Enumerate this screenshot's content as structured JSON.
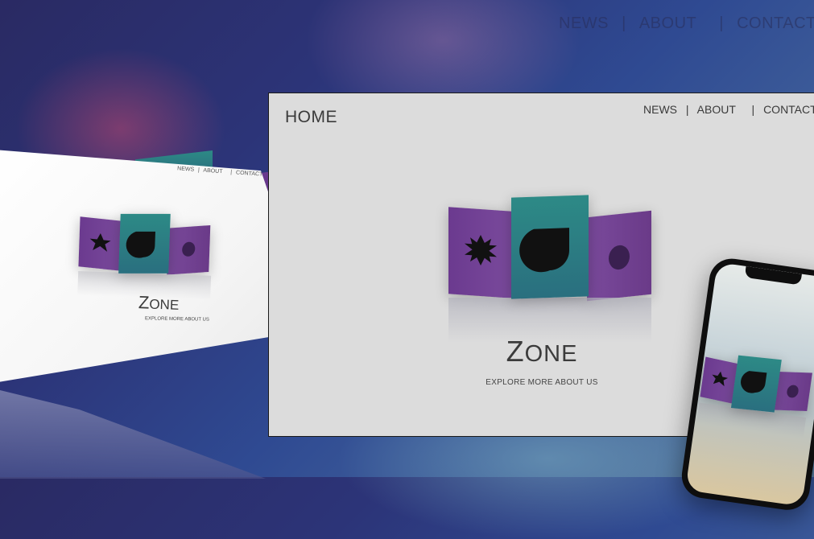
{
  "background": {
    "nav": {
      "news": "NEWS",
      "about": "ABOUT",
      "contact": "CONTACT",
      "sep": "|"
    }
  },
  "desktop": {
    "home": "HOME",
    "nav": {
      "news": "NEWS",
      "about": "ABOUT",
      "contact": "CONTACT",
      "sep": "|"
    },
    "brand_first": "Z",
    "brand_rest": "ONE",
    "tagline": "EXPLORE MORE ABOUT US"
  },
  "tablet": {
    "nav": {
      "news": "NEWS",
      "about": "ABOUT",
      "contact": "CONTACT",
      "sep": "|"
    },
    "brand_first": "Z",
    "brand_rest": "ONE",
    "tagline": "EXPLORE MORE ABOUT US"
  },
  "colors": {
    "purple_card": "#6b3a8f",
    "teal_card": "#2d8a86",
    "screen_bg": "#dcdcdc"
  },
  "icons": [
    "star-icon",
    "drop-icon",
    "circle-icon"
  ]
}
